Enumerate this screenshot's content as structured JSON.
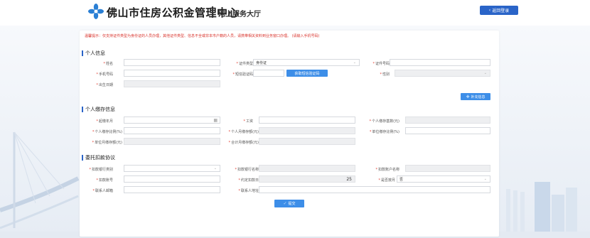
{
  "header": {
    "site_title": "佛山市住房公积金管理中心",
    "site_subtitle": "网上服务大厅",
    "back_button": "返回登录"
  },
  "notice": {
    "text": "温馨提示：仅支持证件类型为身份证的人员办理，其他证件类型、信息不全或非本市户籍的人员，请携带相关资料到业务窗口办理。",
    "link": "(请输入手机号码)"
  },
  "personal_info": {
    "section_title": "个人信息",
    "name_label": "姓名",
    "id_type_label": "证件类型",
    "id_type_value": "身份证",
    "id_number_label": "证件号码",
    "phone_label": "手机号码",
    "sms_code_label": "短信验证码",
    "get_code_button": "获取短信验证码",
    "gender_label": "性别",
    "birth_date_label": "出生日期",
    "more_info_button": "补充信息"
  },
  "deposit_info": {
    "section_title": "个人缴存信息",
    "start_month_label": "起缴年月",
    "salary_label": "工资",
    "base_label": "个人缴存基数(元)",
    "personal_ratio_label": "个人缴存比例(%)",
    "personal_amount_label": "个人月缴存额(元)",
    "unit_ratio_label": "单位缴存比例(%)",
    "unit_amount_label": "单位月缴存额(元)",
    "total_amount_label": "合计月缴存额(元)"
  },
  "agreement": {
    "section_title": "委托扣款协议",
    "bank_category_label": "扣款银行类别",
    "bank_name_label": "扣款银行名称",
    "account_name_label": "扣款账户名称",
    "account_number_label": "扣款账号",
    "deduct_day_label": "约定扣款日",
    "deduct_day_value": "25",
    "pay_monthly_label": "是否按月",
    "pay_monthly_value": "否",
    "contact_email_label": "联系人邮箱",
    "contact_address_label": "联系人地址",
    "submit_button": "提交"
  },
  "colors": {
    "accent": "#2a64c8",
    "button": "#3d8ee8",
    "required": "#e23b2e",
    "notice": "#d9322b"
  }
}
